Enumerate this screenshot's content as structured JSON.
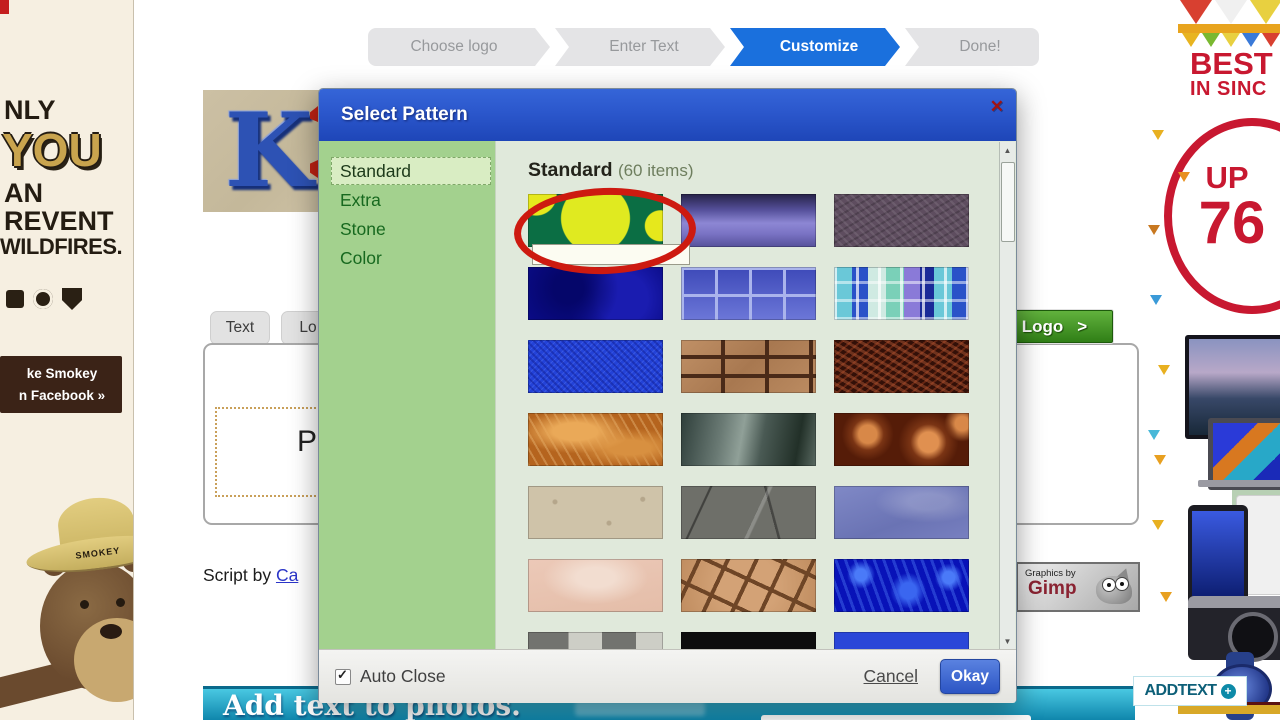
{
  "wizard": {
    "steps": [
      {
        "label": "Choose logo",
        "active": false
      },
      {
        "label": "Enter Text",
        "active": false
      },
      {
        "label": "Customize",
        "active": true
      },
      {
        "label": "Done!",
        "active": false
      }
    ]
  },
  "left_ad": {
    "lines": [
      {
        "text": "NLY",
        "size": "md"
      },
      {
        "text": "YOU",
        "size": "xl"
      },
      {
        "text": "AN",
        "size": "md"
      },
      {
        "text": "REVENT",
        "size": "md"
      },
      {
        "text": "WILDFIRES.",
        "size": "sm"
      }
    ],
    "facebook_box": {
      "line1": "ke Smokey",
      "line2": "n Facebook »"
    },
    "smokey_hat_text": "SMOKEY"
  },
  "right_ad": {
    "headline_line1": "BEST",
    "headline_line2": "IN SINC",
    "badge_line1": "UP",
    "badge_line2": "76",
    "accent_color": "#c81830"
  },
  "logo_preview": {
    "letter": "K"
  },
  "workspace": {
    "tab_text": "Text",
    "tab_logo": "Lo",
    "dropzone_label": "Pa",
    "logo_button_label": "Logo",
    "logo_button_arrow": ">",
    "script_credit_text": "Script by",
    "script_credit_link": "Ca"
  },
  "gimp_badge": {
    "line1": "Graphics by",
    "line2": "Gimp"
  },
  "banner": {
    "headline": "Add text to photos.",
    "brand": "ADDTEXT",
    "brand_plus": "+"
  },
  "dialog": {
    "title": "Select Pattern",
    "close_icon": "✕",
    "title_bar_color": "#2b57cc",
    "sidebar_color": "#a3d18e",
    "categories": [
      {
        "label": "Standard",
        "selected": true
      },
      {
        "label": "Extra",
        "selected": false
      },
      {
        "label": "Stone",
        "selected": false
      },
      {
        "label": "Color",
        "selected": false
      }
    ],
    "content_header": {
      "category": "Standard",
      "count": "(60 items)"
    },
    "patterns": [
      {
        "name": "green-yellow-blob",
        "style": "p-green",
        "circled": true,
        "tooltip": true
      },
      {
        "name": "purple-sheen",
        "style": "p-purple"
      },
      {
        "name": "mauve-marble",
        "style": "p-mauve"
      },
      {
        "name": "navy-clouds",
        "style": "p-navy"
      },
      {
        "name": "blue-grid-tiles",
        "style": "p-grid"
      },
      {
        "name": "pastel-mosaic",
        "style": "p-mosaic"
      },
      {
        "name": "royal-blue-noise",
        "style": "p-royal"
      },
      {
        "name": "brick-wall",
        "style": "p-brick"
      },
      {
        "name": "dark-ember",
        "style": "p-ember"
      },
      {
        "name": "orange-marble",
        "style": "p-omarble"
      },
      {
        "name": "teal-stone",
        "style": "p-tstone"
      },
      {
        "name": "copper-swirls",
        "style": "p-copper"
      },
      {
        "name": "beige-stone",
        "style": "p-beige"
      },
      {
        "name": "grey-slate",
        "style": "p-slate"
      },
      {
        "name": "periwinkle-stone",
        "style": "p-peri"
      },
      {
        "name": "pink-sand",
        "style": "p-psand"
      },
      {
        "name": "cracked-mud",
        "style": "p-mud"
      },
      {
        "name": "blue-water",
        "style": "p-water"
      },
      {
        "name": "partial-grey",
        "style": "p-part1"
      },
      {
        "name": "partial-black",
        "style": "p-part2"
      },
      {
        "name": "partial-blue",
        "style": "p-part3"
      }
    ],
    "footer": {
      "auto_close_label": "Auto Close",
      "auto_close_checked": true,
      "cancel_label": "Cancel",
      "okay_label": "Okay"
    }
  }
}
